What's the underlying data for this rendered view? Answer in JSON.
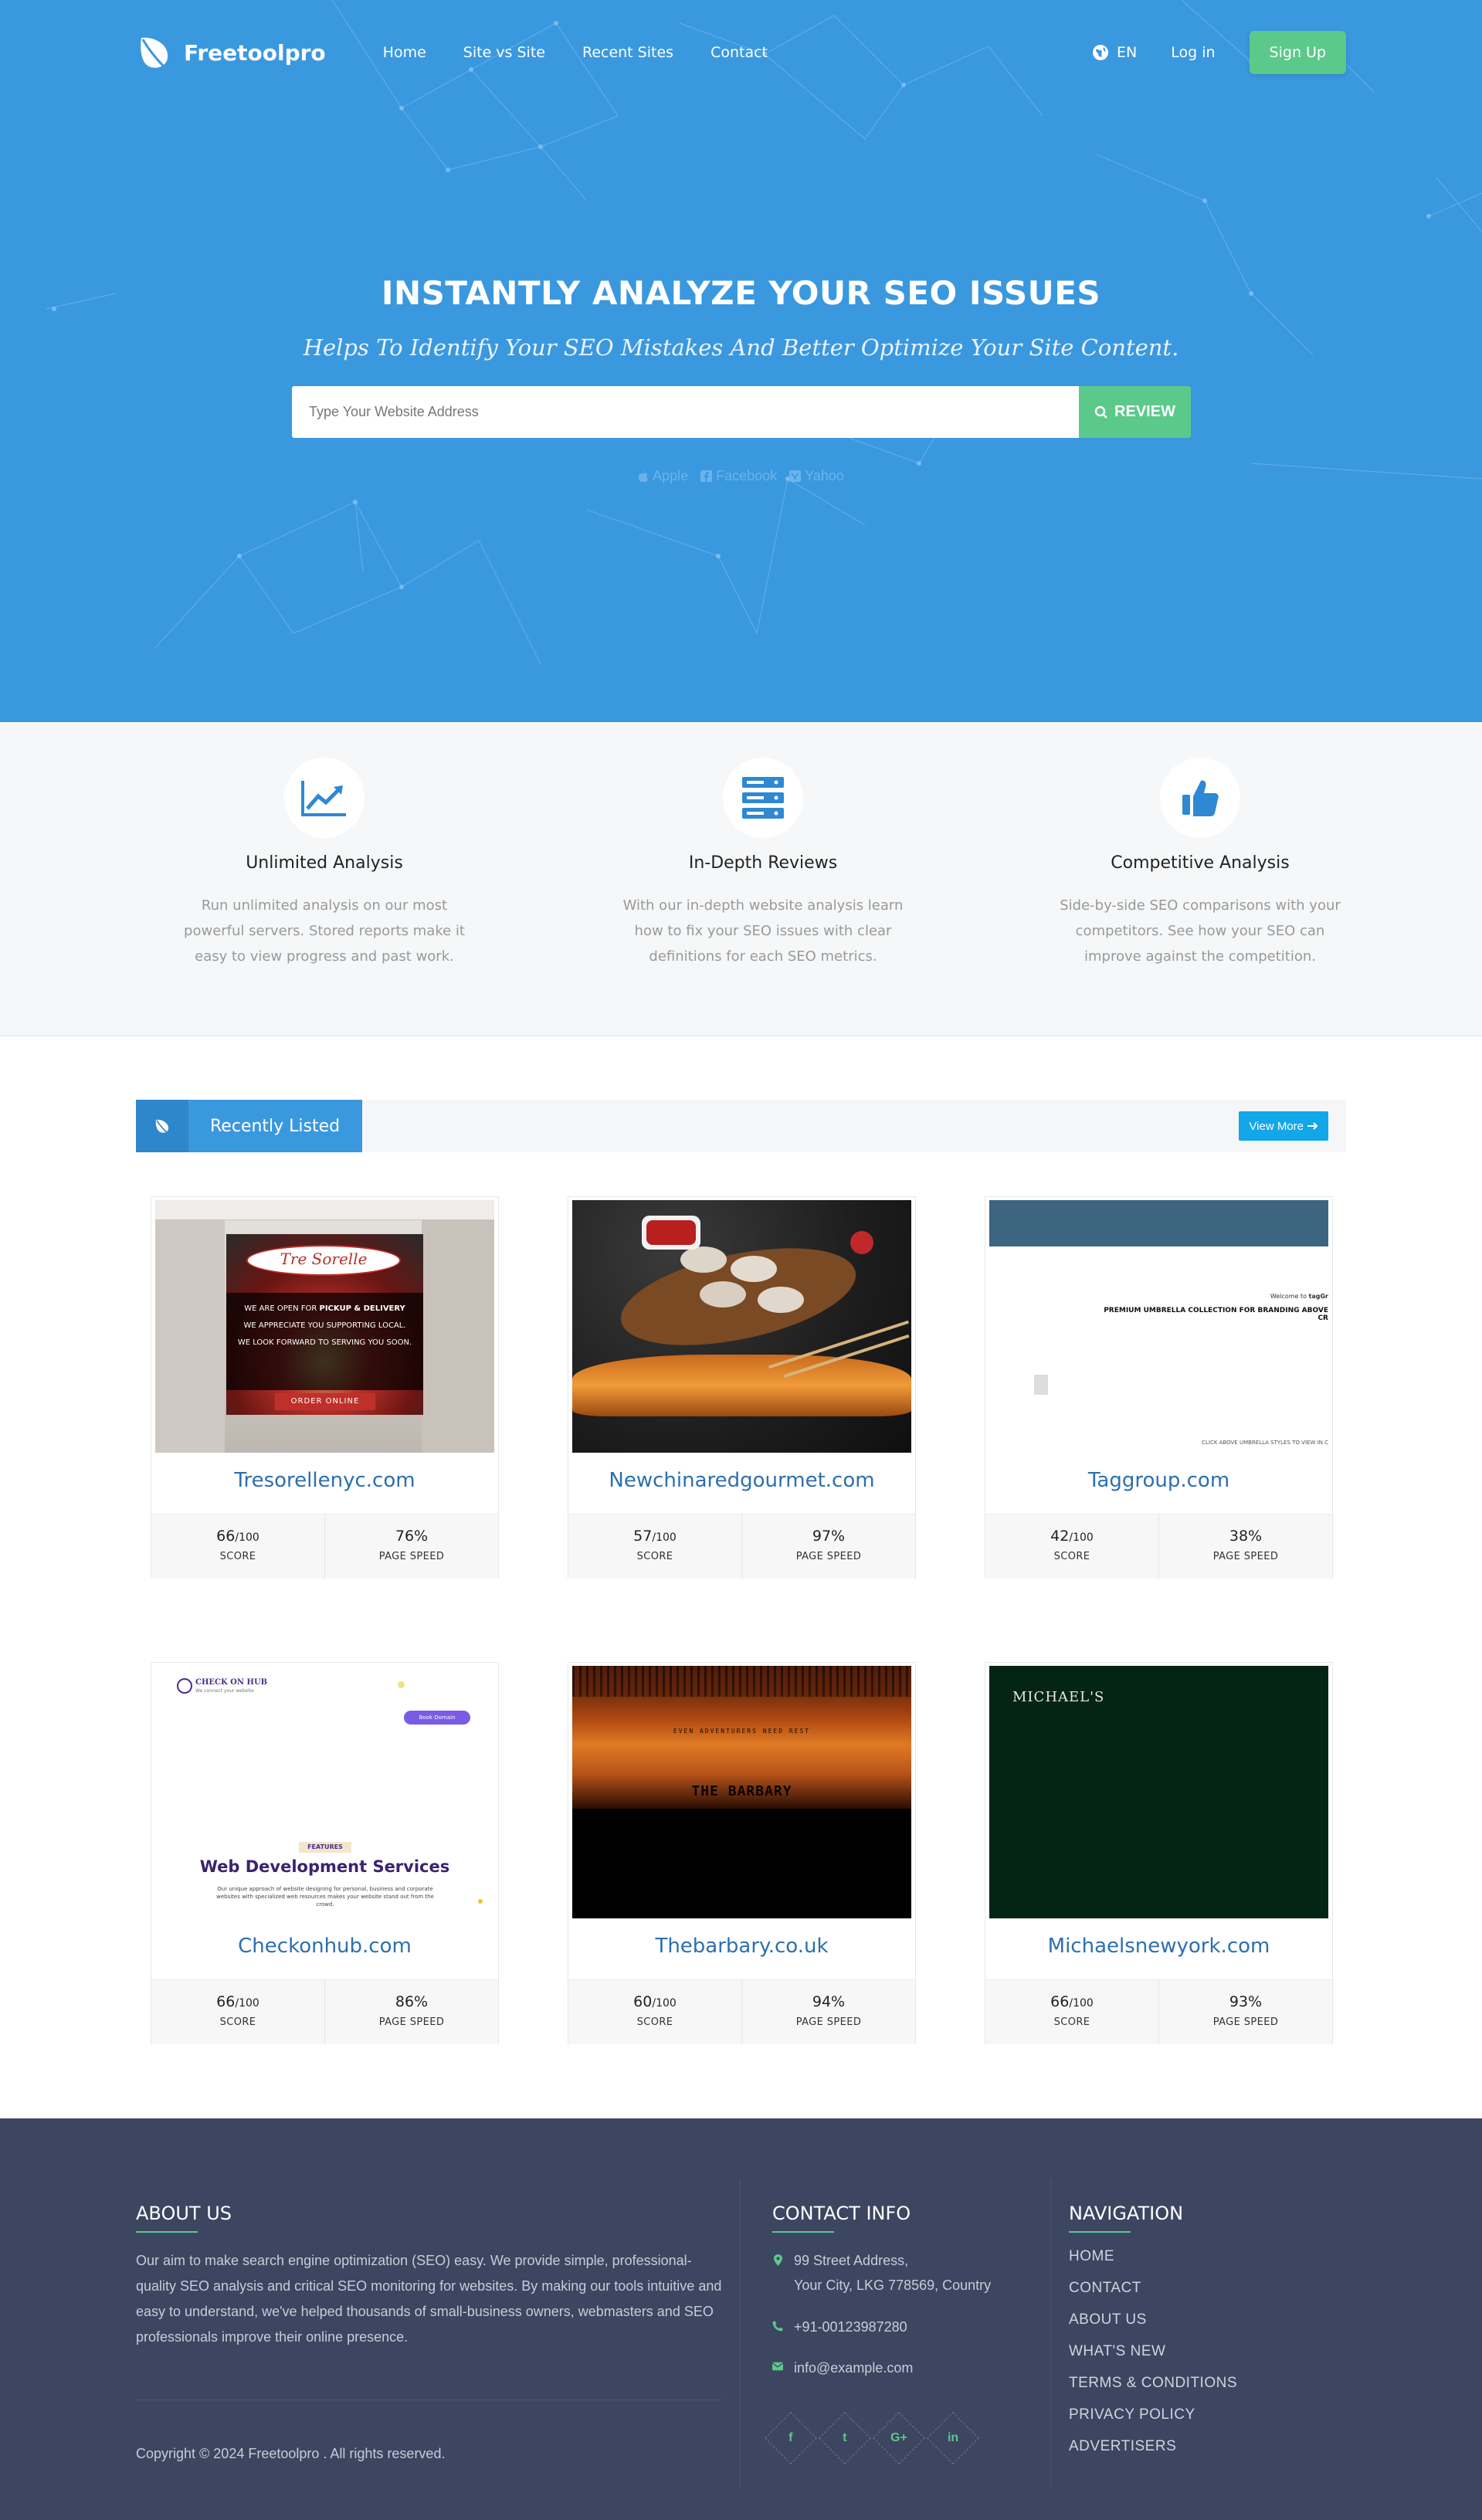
{
  "nav": {
    "brand": "Freetoolpro",
    "links": [
      "Home",
      "Site vs Site",
      "Recent Sites",
      "Contact"
    ],
    "lang": "EN",
    "login": "Log in",
    "signup": "Sign Up"
  },
  "hero": {
    "title": "INSTANTLY ANALYZE YOUR SEO ISSUES",
    "subtitle": "Helps To Identify Your SEO Mistakes And Better Optimize Your Site Content.",
    "search_placeholder": "Type Your Website Address",
    "review_label": "REVIEW",
    "hints": [
      "Apple",
      "Facebook",
      "Yahoo"
    ]
  },
  "features": [
    {
      "icon": "trending-chart-icon",
      "title": "Unlimited Analysis",
      "text": "Run unlimited analysis on our most powerful servers. Stored reports make it easy to view progress and past work."
    },
    {
      "icon": "server-icon",
      "title": "In-Depth Reviews",
      "text": "With our in-depth website analysis learn how to fix your SEO issues with clear definitions for each SEO metrics."
    },
    {
      "icon": "thumbs-up-icon",
      "title": "Competitive Analysis",
      "text": "Side-by-side SEO comparisons with your competitors. See how your SEO can improve against the competition."
    }
  ],
  "recent": {
    "label": "Recently Listed",
    "view_more": "View More",
    "sites": [
      {
        "name": "Tresorellenyc.com",
        "score": "66",
        "score_max": "/100",
        "speed": "76%"
      },
      {
        "name": "Newchinaredgourmet.com",
        "score": "57",
        "score_max": "/100",
        "speed": "97%"
      },
      {
        "name": "Taggroup.com",
        "score": "42",
        "score_max": "/100",
        "speed": "38%"
      },
      {
        "name": "Checkonhub.com",
        "score": "66",
        "score_max": "/100",
        "speed": "86%"
      },
      {
        "name": "Thebarbary.co.uk",
        "score": "60",
        "score_max": "/100",
        "speed": "94%"
      },
      {
        "name": "Michaelsnewyork.com",
        "score": "66",
        "score_max": "/100",
        "speed": "93%"
      }
    ],
    "score_label": "SCORE",
    "speed_label": "PAGE SPEED",
    "thumbs": {
      "tre": {
        "brand": "Tre Sorelle",
        "line1": "WE ARE OPEN FOR",
        "line1b": "PICKUP & DELIVERY",
        "line2": "WE APPRECIATE YOU SUPPORTING LOCAL.",
        "line3": "WE LOOK FORWARD TO SERVING YOU SOON.",
        "cta": "ORDER ONLINE"
      },
      "tag": {
        "welcome": "Welcome to",
        "welcome_brand": "tagGr",
        "headline": "PREMIUM UMBRELLA COLLECTION FOR BRANDING ABOVE",
        "headline2": "CR",
        "footer": "CLICK ABOVE UMBRELLA STYLES TO VIEW IN C"
      },
      "chk": {
        "brand": "CHECK ON HUB",
        "tagline": "We connect your website",
        "btn": "Book Domain",
        "badge": "FEATURES",
        "title": "Web Development Services",
        "desc": "Our unique approach of website designing for personal, business and corporate websites with specialized web resources makes your website stand out from the crowd."
      },
      "bar": {
        "title": "THE BARBARY",
        "sub": "EVEN ADVENTURERS NEED REST"
      },
      "mic": {
        "brand": "MICHAEL'S"
      }
    }
  },
  "footer": {
    "about_title": "ABOUT US",
    "about_text": "Our aim to make search engine optimization (SEO) easy. We provide simple, professional-quality SEO analysis and critical SEO monitoring for websites. By making our tools intuitive and easy to understand, we've helped thousands of small-business owners, webmasters and SEO professionals improve their online presence.",
    "copyright": "Copyright © 2024 Freetoolpro . All rights reserved.",
    "contact_title": "CONTACT INFO",
    "address1": "99 Street Address,",
    "address2": "Your City, LKG 778569, Country",
    "phone": "+91-00123987280",
    "email": "info@example.com",
    "socials": [
      "f",
      "t",
      "G+",
      "in"
    ],
    "nav_title": "NAVIGATION",
    "nav_links": [
      "HOME",
      "CONTACT",
      "ABOUT US",
      "WHAT'S NEW",
      "TERMS & CONDITIONS",
      "PRIVACY POLICY",
      "ADVERTISERS"
    ]
  }
}
